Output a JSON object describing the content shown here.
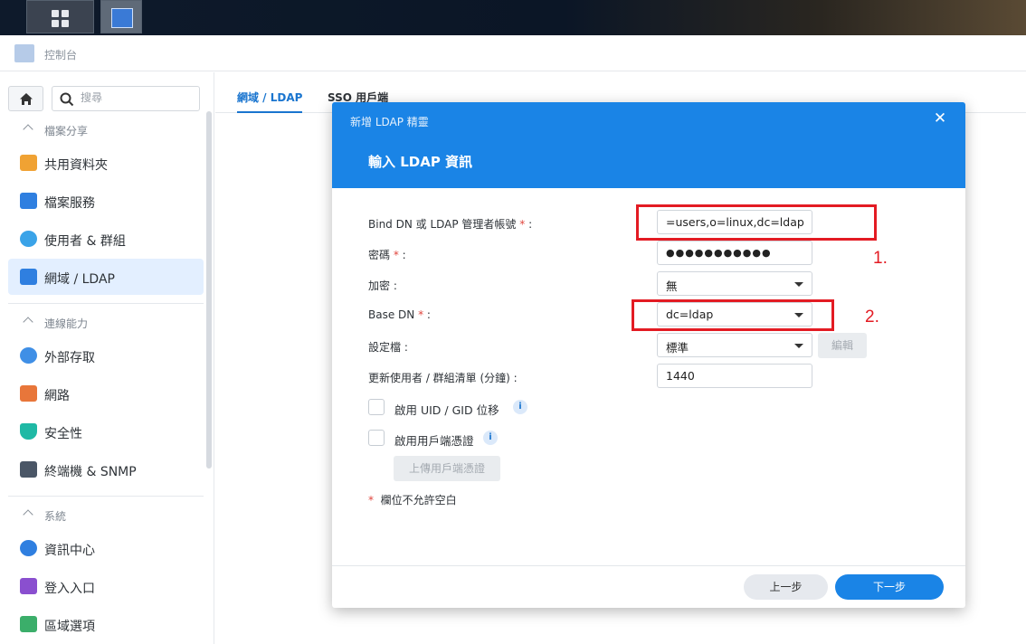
{
  "taskbar": {
    "buttons": [
      "main-menu-icon",
      "control-panel-app-icon"
    ]
  },
  "window": {
    "title": "控制台"
  },
  "sidebar": {
    "search_placeholder": "搜尋",
    "sections": [
      {
        "label": "檔案分享",
        "items": [
          "共用資料夾",
          "檔案服務",
          "使用者 & 群組",
          "網域 / LDAP"
        ]
      },
      {
        "label": "連線能力",
        "items": [
          "外部存取",
          "網路",
          "安全性",
          "終端機 & SNMP"
        ]
      },
      {
        "label": "系統",
        "items": [
          "資訊中心",
          "登入入口",
          "區域選項"
        ]
      }
    ],
    "active_item": "網域 / LDAP"
  },
  "tabs": [
    "網域 / LDAP",
    "SSO 用戶端"
  ],
  "modal": {
    "window_title": "新增 LDAP 精靈",
    "heading": "輸入 LDAP 資訊",
    "fields": {
      "bind_dn_label": "Bind DN 或 LDAP 管理者帳號",
      "bind_dn_value": "=users,o=linux,dc=ldap",
      "password_label": "密碼",
      "password_value": "●●●●●●●●●●●",
      "encryption_label": "加密",
      "encryption_value": "無",
      "base_dn_label": "Base DN",
      "base_dn_value": "dc=ldap",
      "profile_label": "設定檔",
      "profile_value": "標準",
      "edit_button": "編輯",
      "refresh_label": "更新使用者 / 群組清單 (分鐘)",
      "refresh_value": "1440"
    },
    "checkboxes": {
      "uid_gid_label": "啟用 UID / GID 位移",
      "client_cert_label": "啟用用戶端憑證"
    },
    "upload_button": "上傳用戶端憑證",
    "required_note": "欄位不允許空白",
    "buttons": {
      "prev": "上一步",
      "next": "下一步"
    }
  },
  "annotations": {
    "label_1": "1.",
    "label_2": "2.",
    "color": "#e31b23"
  },
  "colors": {
    "accent": "#1a84e6",
    "active_bg": "#e3efff",
    "required": "#e0453d"
  }
}
